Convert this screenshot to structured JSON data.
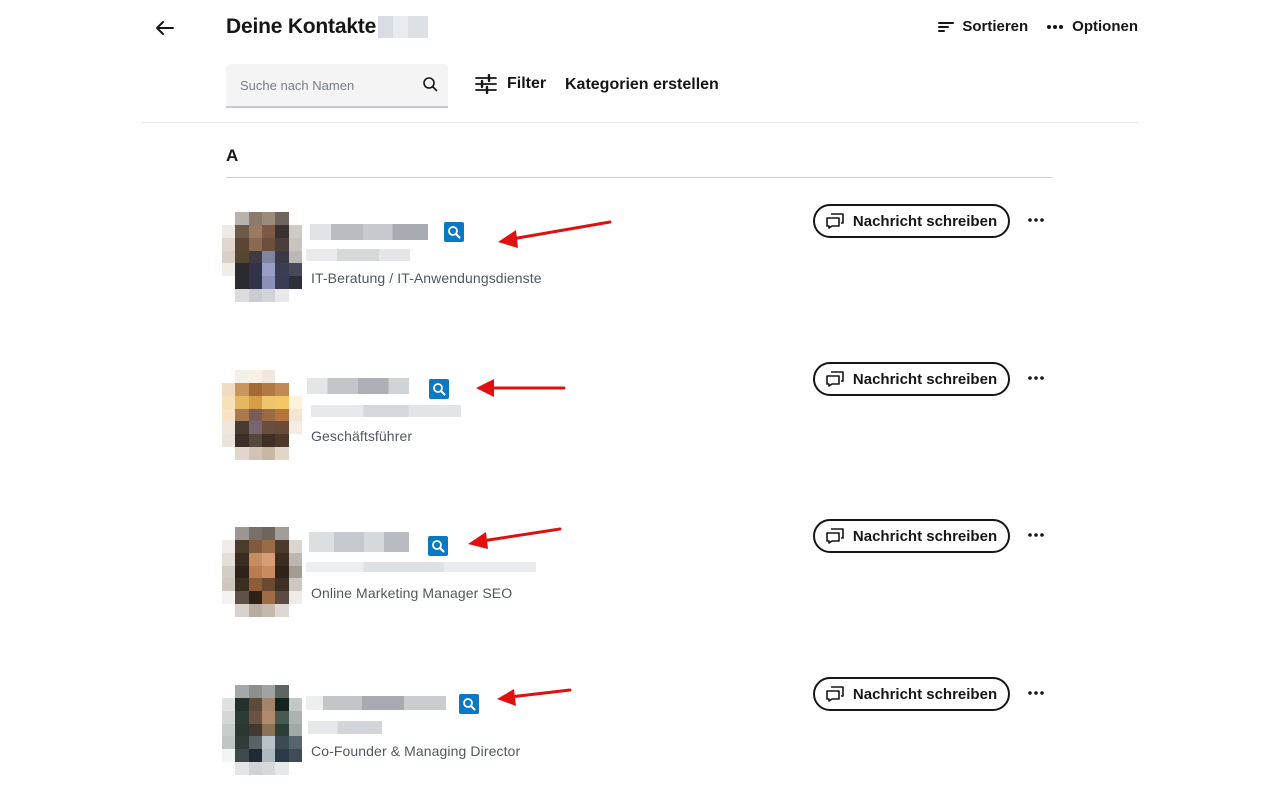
{
  "header": {
    "title": "Deine Kontakte",
    "sort_label": "Sortieren",
    "options_label": "Optionen"
  },
  "toolbar": {
    "search_placeholder": "Suche nach Namen",
    "filter_label": "Filter",
    "categories_label": "Kategorien erstellen"
  },
  "section": {
    "letter": "A"
  },
  "contacts": [
    {
      "job": "IT-Beratung / IT-Anwendungsdienste",
      "message_label": "Nachricht schreiben"
    },
    {
      "job": "Geschäftsführer",
      "message_label": "Nachricht schreiben"
    },
    {
      "job": "Online Marketing Manager SEO",
      "message_label": "Nachricht schreiben"
    },
    {
      "job": "Co-Founder & Managing Director",
      "message_label": "Nachricht schreiben"
    }
  ],
  "colors": {
    "badge": "#0a78c2",
    "arrow": "#e11010",
    "text": "#161616",
    "muted": "#4f5862"
  },
  "icons": {
    "back": "arrow-left-icon",
    "sort": "sort-icon",
    "options": "more-horizontal-icon",
    "search": "search-icon",
    "filter": "sliders-icon",
    "message": "chat-bubble-icon",
    "badge": "magnifier-badge-icon"
  }
}
